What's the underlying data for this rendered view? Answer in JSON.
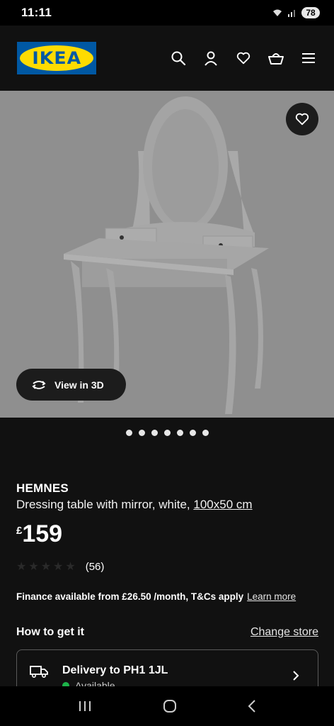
{
  "status_bar": {
    "time": "11:11",
    "battery": "78"
  },
  "header": {
    "logo_text": "IKEA",
    "icons": [
      "search-icon",
      "account-icon",
      "heart-icon",
      "basket-icon",
      "menu-icon"
    ]
  },
  "hero": {
    "view_3d_label": "View in 3D",
    "favourite_icon": "heart-icon",
    "carousel_count": 7,
    "carousel_active": 0
  },
  "product": {
    "name": "HEMNES",
    "description": "Dressing table with mirror, white,",
    "size_link": "100x50 cm",
    "currency": "£",
    "price": "159",
    "rating_stars": 5,
    "review_count": "(56)"
  },
  "finance": {
    "text": "Finance available from £26.50 /month, T&Cs apply",
    "learn_more": "Learn more"
  },
  "how_to_get": {
    "title": "How to get it",
    "change_store": "Change store"
  },
  "delivery": {
    "title": "Delivery to PH1 1JL",
    "status": "Available",
    "status_color": "#1db44a"
  },
  "colors": {
    "brand_blue": "#0058a3",
    "brand_yellow": "#ffdb00",
    "background": "#111111"
  }
}
